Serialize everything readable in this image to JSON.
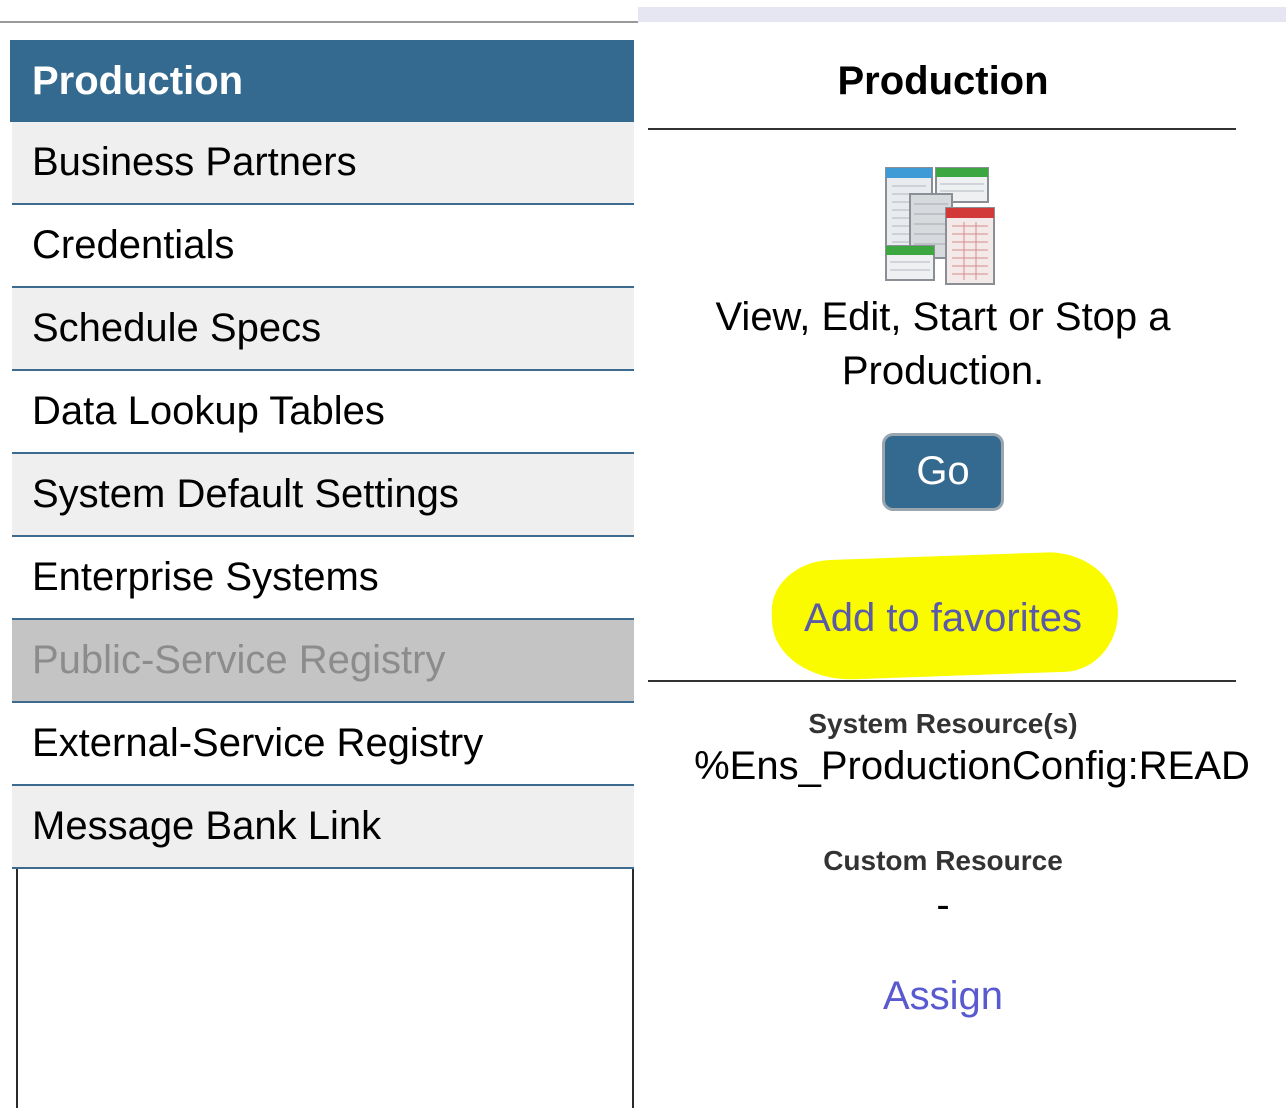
{
  "sidebar": {
    "header": "Production",
    "items": [
      {
        "label": "Business Partners"
      },
      {
        "label": "Credentials"
      },
      {
        "label": "Schedule Specs"
      },
      {
        "label": "Data Lookup Tables"
      },
      {
        "label": "System Default Settings"
      },
      {
        "label": "Enterprise Systems"
      },
      {
        "label": "Public-Service Registry",
        "disabled": true
      },
      {
        "label": "External-Service Registry"
      },
      {
        "label": "Message Bank Link"
      }
    ]
  },
  "detail": {
    "title": "Production",
    "icon": "production-tables-icon",
    "description": "View, Edit, Start or Stop a Production.",
    "go_label": "Go",
    "favorites_label": "Add to favorites",
    "highlight_color": "#fbfb00",
    "system_resource_label": "System Resource(s)",
    "system_resource_value": "%Ens_ProductionConfig:READ",
    "custom_resource_label": "Custom Resource",
    "custom_resource_value": "-",
    "assign_label": "Assign"
  },
  "colors": {
    "accent": "#346a8f",
    "link": "#5a5ad0",
    "disabled_bg": "#c4c4c4"
  }
}
